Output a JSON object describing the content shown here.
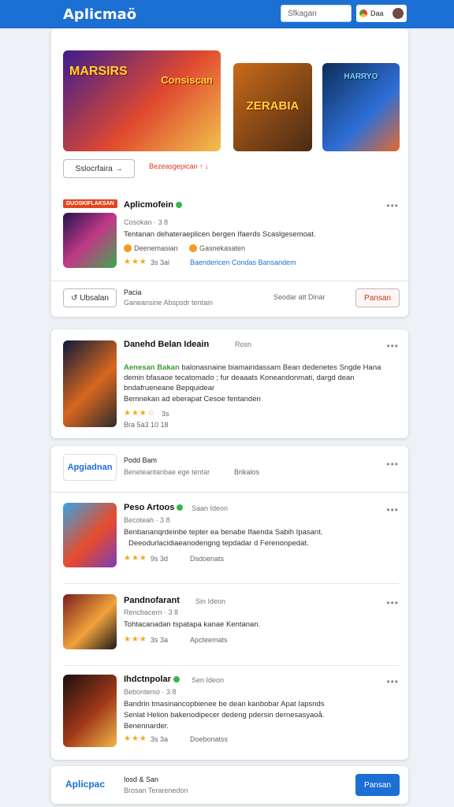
{
  "header": {
    "logo": "Aplicmaö",
    "search_placeholder": "Sfkagan",
    "user_label": "Daa"
  },
  "hero": {
    "thumbs": [
      {
        "title": "MARSIRS",
        "subtitle": "Consiscan"
      },
      {
        "title": "ZERABIA"
      },
      {
        "title": "HARRYO"
      }
    ],
    "select_label": "Sslocrfaira →",
    "promo_text": "Bezeasgepican ↑ ↓"
  },
  "featured": {
    "badge": "DUOSKIFLAKSAN",
    "title": "Aplicmofein",
    "sub": "Cosokan · 3 8",
    "desc": "Tentanan dehateraeplicen bergen Ifaerds Scaslgesemoat.",
    "chip1": "Deenemasian",
    "chip2": "Gasnekasaten",
    "rating": "3s 3ai",
    "link": "Baendericen Condas Bansandem",
    "follow_label": "↺ Ubsalan",
    "footer_title": "Pacia",
    "footer_sub": "Ganeansine Abspsdr tentain",
    "share_label": "Seodar att Dinar",
    "action_label": "Pansan"
  },
  "post": {
    "title": "Danehd Belan Ideain",
    "title_sub": "Rosn",
    "line1_hl": "Aenesan Bakan",
    "line1": "balonasnaine biamairidassam Bean dedenetes Sngde Hana",
    "line2": "demin bfasaoe tecatomado ; fur deaaats Koneandonmati, dargd dean",
    "line3": "bndafrueneane Bepquidear",
    "line4": "Bemnekan ad eberapat Cesoe fentanden",
    "rating": "3s",
    "meta": "Bra 5a3 10 18"
  },
  "list_header": {
    "brand": "Apgiadnan",
    "title": "Podd Bam",
    "sub": "Beneteantanbae ege tentar",
    "tag": "Brikalos"
  },
  "items": [
    {
      "title": "Peso Artoos",
      "sub": "Becoteah · 3 8",
      "sub2": "Saan Ideon",
      "body": "Benbananqrdeinbe tepter ea benabe Ifaenda Sabih Ipasant.",
      "body2": "Deeodurlacidiaeanodengng tepdadar d Ferenonpedat.",
      "rating": "9s 3d",
      "meta": "Dsdoenats"
    },
    {
      "title": "Pandnofarant",
      "sub": "Rencbacern · 3 8",
      "sub2": "Sin Ideon",
      "body": "Tohtacanadan tspatapa kanae Kentanan.",
      "rating": "3s 3a",
      "meta": "Apcteemats"
    },
    {
      "title": "Ihdctnpolar",
      "sub": "Bebontemo · 3 8",
      "sub2": "Sen Ideon",
      "body": "Bandrin tmasinancopbienee be dean kanbobar Apat Iapsnds",
      "body2": "Senlat Helion bakenodipecer dedeng pdersin dernesasyaoå.",
      "body3": "Benennarder.",
      "rating": "3s 3a",
      "meta": "Doebonatss"
    }
  ],
  "bottom": {
    "brand": "Aplicpac",
    "title": "Iosd & San",
    "sub": "Brosan Terarenedon",
    "button": "Pansan"
  }
}
